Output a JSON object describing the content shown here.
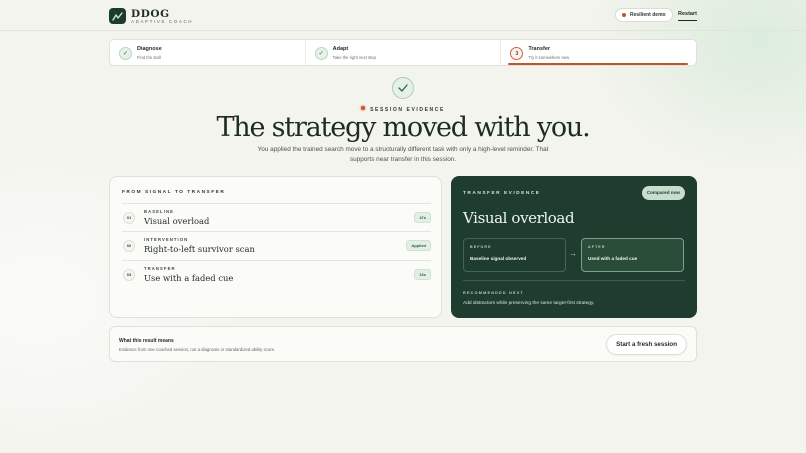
{
  "brand": {
    "name": "DDOG",
    "subtitle": "ADAPTIVE COACH",
    "icon": "logo-mark-icon"
  },
  "header": {
    "demo_label": "Resilient demo",
    "restart_label": "Restart"
  },
  "stepper": [
    {
      "title": "Diagnose",
      "desc": "Find the stall",
      "state": "done"
    },
    {
      "title": "Adapt",
      "desc": "Take the right next step",
      "state": "done"
    },
    {
      "title": "Transfer",
      "desc": "Try it somewhere new",
      "state": "current",
      "number": "3"
    }
  ],
  "hero": {
    "eyebrow": "SESSION EVIDENCE",
    "title": "The strategy moved with you.",
    "subtitle": "You applied the trained search move to a structurally different task with only a high-level reminder. That supports near transfer in this session."
  },
  "signal": {
    "label": "FROM SIGNAL TO TRANSFER",
    "rows": [
      {
        "num": "01",
        "kicker": "BASELINE",
        "value": "Visual overload",
        "badge": "47s"
      },
      {
        "num": "02",
        "kicker": "INTERVENTION",
        "value": "Right-to-left survivor scan",
        "badge": "Applied"
      },
      {
        "num": "03",
        "kicker": "TRANSFER",
        "value": "Use with a faded cue",
        "badge": "16s"
      }
    ]
  },
  "evidence": {
    "label": "TRANSFER EVIDENCE",
    "compared_label": "Compared now",
    "title": "Visual overload",
    "before": {
      "kicker": "BEFORE",
      "value": "Baseline signal observed"
    },
    "after": {
      "kicker": "AFTER",
      "value": "Used with a faded cue"
    },
    "recommended_kicker": "RECOMMENDED NEXT",
    "recommended_text": "Add distractors while preserving the same target-first strategy."
  },
  "meaning": {
    "title": "What this result means",
    "desc": "Evidence from one coached session, not a diagnosis or standardized ability score.",
    "button_label": "Start a fresh session"
  },
  "colors": {
    "accent": "#c4542c",
    "dark_green": "#1e3d2e",
    "success": "#2f6a44"
  }
}
